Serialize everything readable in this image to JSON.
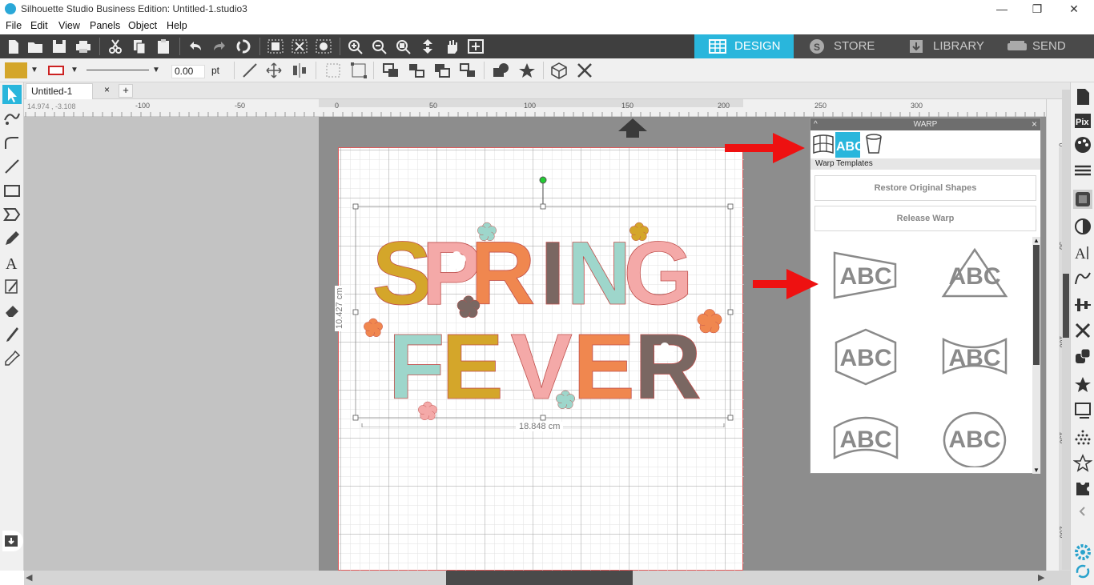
{
  "window": {
    "title": "Silhouette Studio Business Edition: Untitled-1.studio3",
    "controls": {
      "minimize": "—",
      "maximize": "❐",
      "close": "✕"
    }
  },
  "menu": [
    "File",
    "Edit",
    "View",
    "Panels",
    "Object",
    "Help"
  ],
  "nav_tabs": [
    {
      "label": "DESIGN",
      "active": true
    },
    {
      "label": "STORE",
      "active": false
    },
    {
      "label": "LIBRARY",
      "active": false
    },
    {
      "label": "SEND",
      "active": false
    }
  ],
  "properties": {
    "fill_color": "#d4a62a",
    "line_color": "#cc2222",
    "line_width": "0.00",
    "line_unit": "pt"
  },
  "document": {
    "tab_label": "Untitled-1",
    "close_glyph": "×",
    "add_glyph": "+",
    "cursor_coords": "14.974 , -3.108"
  },
  "rulers": {
    "top": [
      "-100",
      "-50",
      "0",
      "50",
      "100",
      "150",
      "200",
      "250",
      "300"
    ],
    "right": [
      "0",
      "50",
      "100",
      "150",
      "200"
    ]
  },
  "design": {
    "line1": [
      "S",
      "P",
      "R",
      "I",
      "N",
      "G"
    ],
    "line2": [
      "F",
      "E",
      "V",
      "E",
      "R"
    ],
    "height_label": "10.427 cm",
    "width_label": "18.848 cm",
    "colors": {
      "mustard": "#d4a62a",
      "pink": "#f4a9a8",
      "orange": "#f0874f",
      "brown": "#7a6762",
      "mint": "#9ed6cb"
    }
  },
  "warp_panel": {
    "title": "WARP",
    "collapse_glyph": "^",
    "close_glyph": "×",
    "section_label": "Warp Templates",
    "restore_button": "Restore Original Shapes",
    "release_button": "Release Warp",
    "template_text": "ABC",
    "template_tab_label": "ABC"
  }
}
